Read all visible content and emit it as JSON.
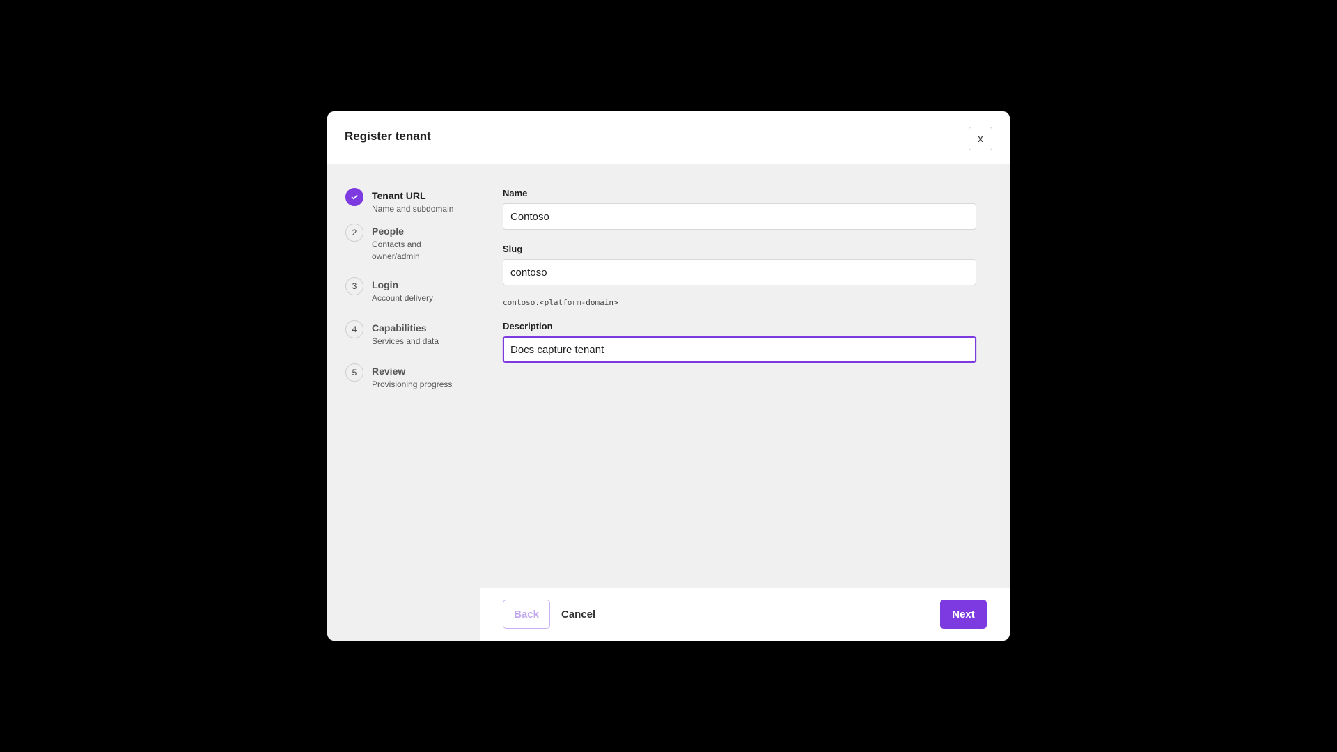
{
  "dialog": {
    "title": "Register tenant",
    "close_label": "x"
  },
  "steps": [
    {
      "number": "",
      "title": "Tenant URL",
      "description": "Name and subdomain",
      "state": "complete"
    },
    {
      "number": "2",
      "title": "People",
      "description": "Contacts and owner/admin",
      "state": "pending"
    },
    {
      "number": "3",
      "title": "Login",
      "description": "Account delivery",
      "state": "pending"
    },
    {
      "number": "4",
      "title": "Capabilities",
      "description": "Services and data",
      "state": "pending"
    },
    {
      "number": "5",
      "title": "Review",
      "description": "Provisioning progress",
      "state": "pending"
    }
  ],
  "form": {
    "name_label": "Name",
    "name_value": "Contoso",
    "slug_label": "Slug",
    "slug_value": "contoso",
    "domain_hint": "contoso.<platform-domain>",
    "description_label": "Description",
    "description_value": "Docs capture tenant"
  },
  "footer": {
    "back_label": "Back",
    "cancel_label": "Cancel",
    "next_label": "Next"
  },
  "colors": {
    "accent": "#7c3ae0",
    "backdrop": "#000000",
    "panel": "#f0f0f0"
  },
  "icons": {
    "step_complete": "check-icon"
  }
}
